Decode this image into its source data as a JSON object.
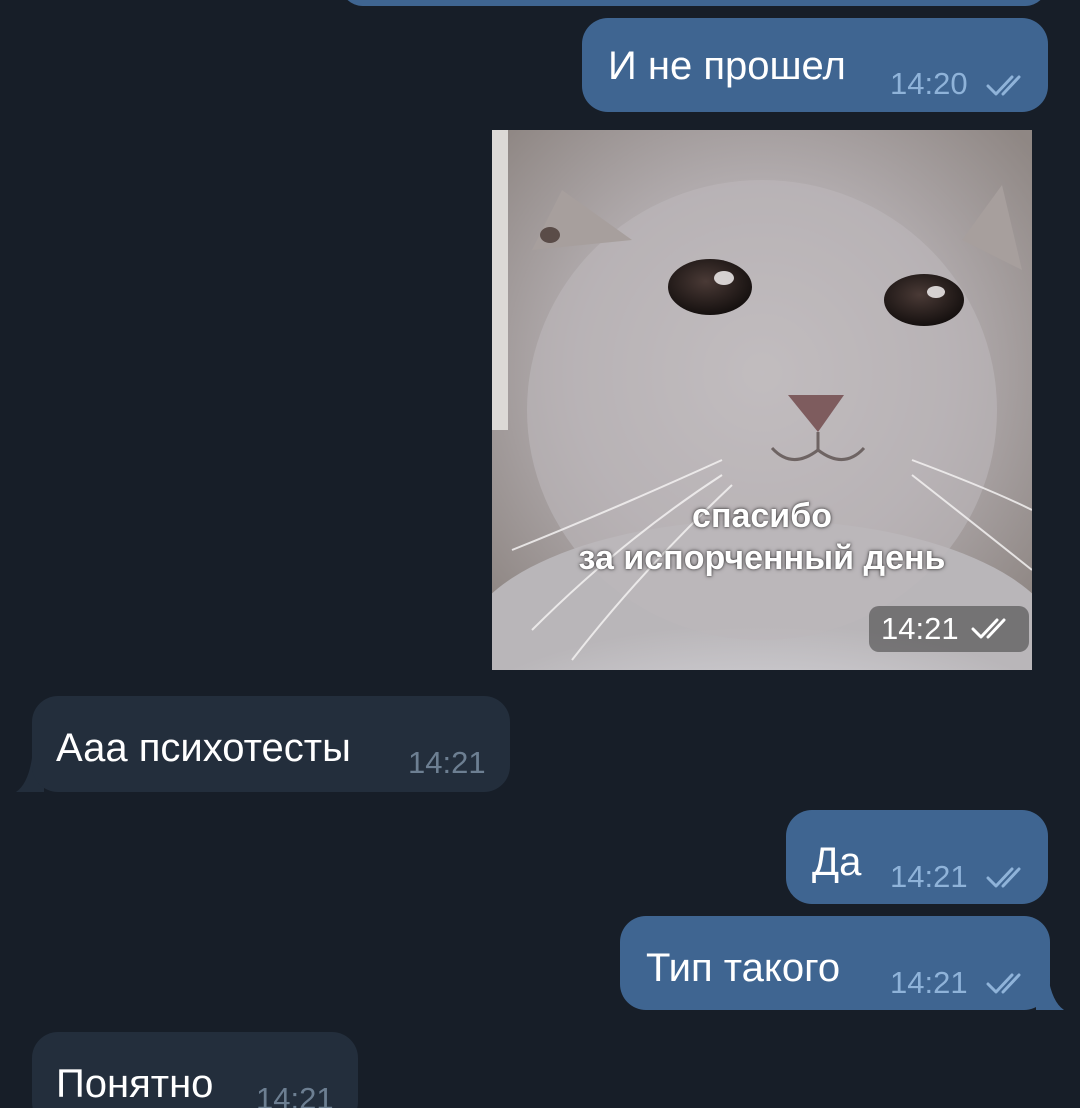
{
  "colors": {
    "background": "#171e28",
    "outgoing_bubble": "#3f6591",
    "incoming_bubble": "#232e3c",
    "outgoing_time": "#8fb3d9",
    "incoming_time": "#6d7f92",
    "read_ticks": "#8fb3d9"
  },
  "messages": [
    {
      "direction": "outgoing",
      "text": "И не прошел",
      "time": "14:20",
      "status": "read"
    },
    {
      "direction": "outgoing",
      "type": "photo",
      "caption_lines": [
        "спасибо",
        "за испорченный день"
      ],
      "time": "14:21",
      "status": "read"
    },
    {
      "direction": "incoming",
      "text": "Ааа психотесты",
      "time": "14:21"
    },
    {
      "direction": "outgoing",
      "text": "Да",
      "time": "14:21",
      "status": "read"
    },
    {
      "direction": "outgoing",
      "text": "Тип такого",
      "time": "14:21",
      "status": "read"
    },
    {
      "direction": "incoming",
      "text": "Понятно",
      "time": "14:21"
    }
  ]
}
